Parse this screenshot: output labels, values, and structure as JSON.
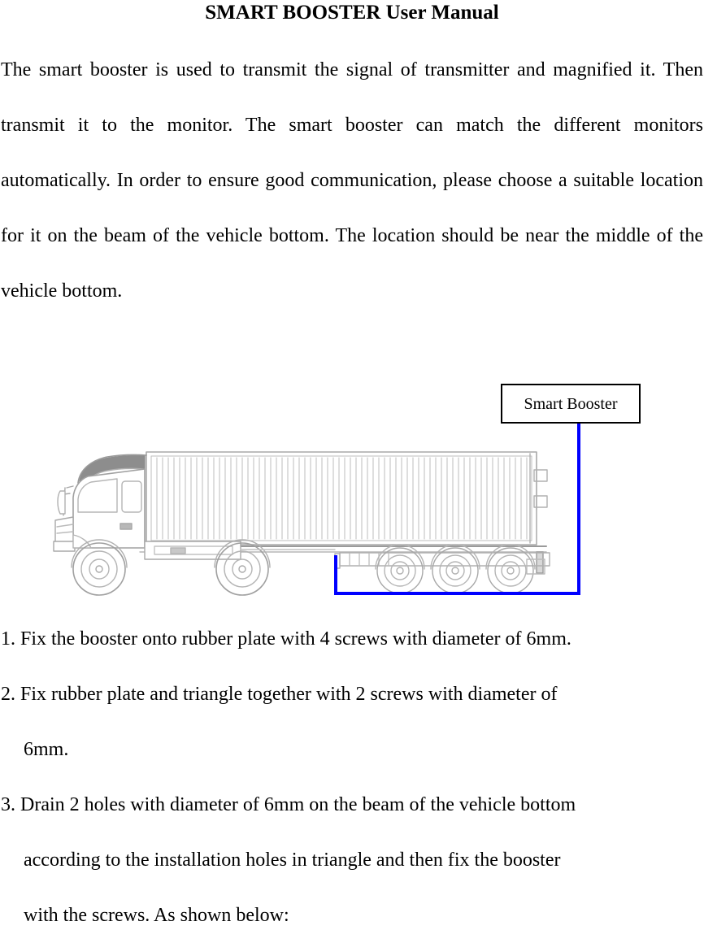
{
  "document": {
    "title": "SMART BOOSTER User Manual",
    "intro": "The smart booster is used to transmit the signal of transmitter and magnified it.  Then transmit it to the monitor. The smart booster can match the different monitors automatically. In order to ensure good communication, please choose a suitable location for it on the beam of the vehicle bottom. The location should be near the middle of the vehicle bottom."
  },
  "figure": {
    "callout_label": "Smart Booster",
    "leader_color": "#0000ff",
    "callout_border_color": "#000000",
    "illustration_name": "semi-truck-side-view",
    "illustration_color": "#9a9a9a"
  },
  "steps": [
    {
      "number": "1.",
      "text": "1. Fix the booster onto rubber plate with 4 screws with diameter of 6mm."
    },
    {
      "number": "2.",
      "text": "2. Fix rubber plate and triangle together with 2 screws with diameter of"
    },
    {
      "number": "",
      "text": "6mm."
    },
    {
      "number": "3.",
      "text": "3. Drain 2 holes with diameter of 6mm on the beam of the vehicle bottom"
    },
    {
      "number": "",
      "text": "according to the installation holes in triangle and then fix the booster"
    },
    {
      "number": "",
      "text": "with the screws. As shown below:"
    }
  ]
}
